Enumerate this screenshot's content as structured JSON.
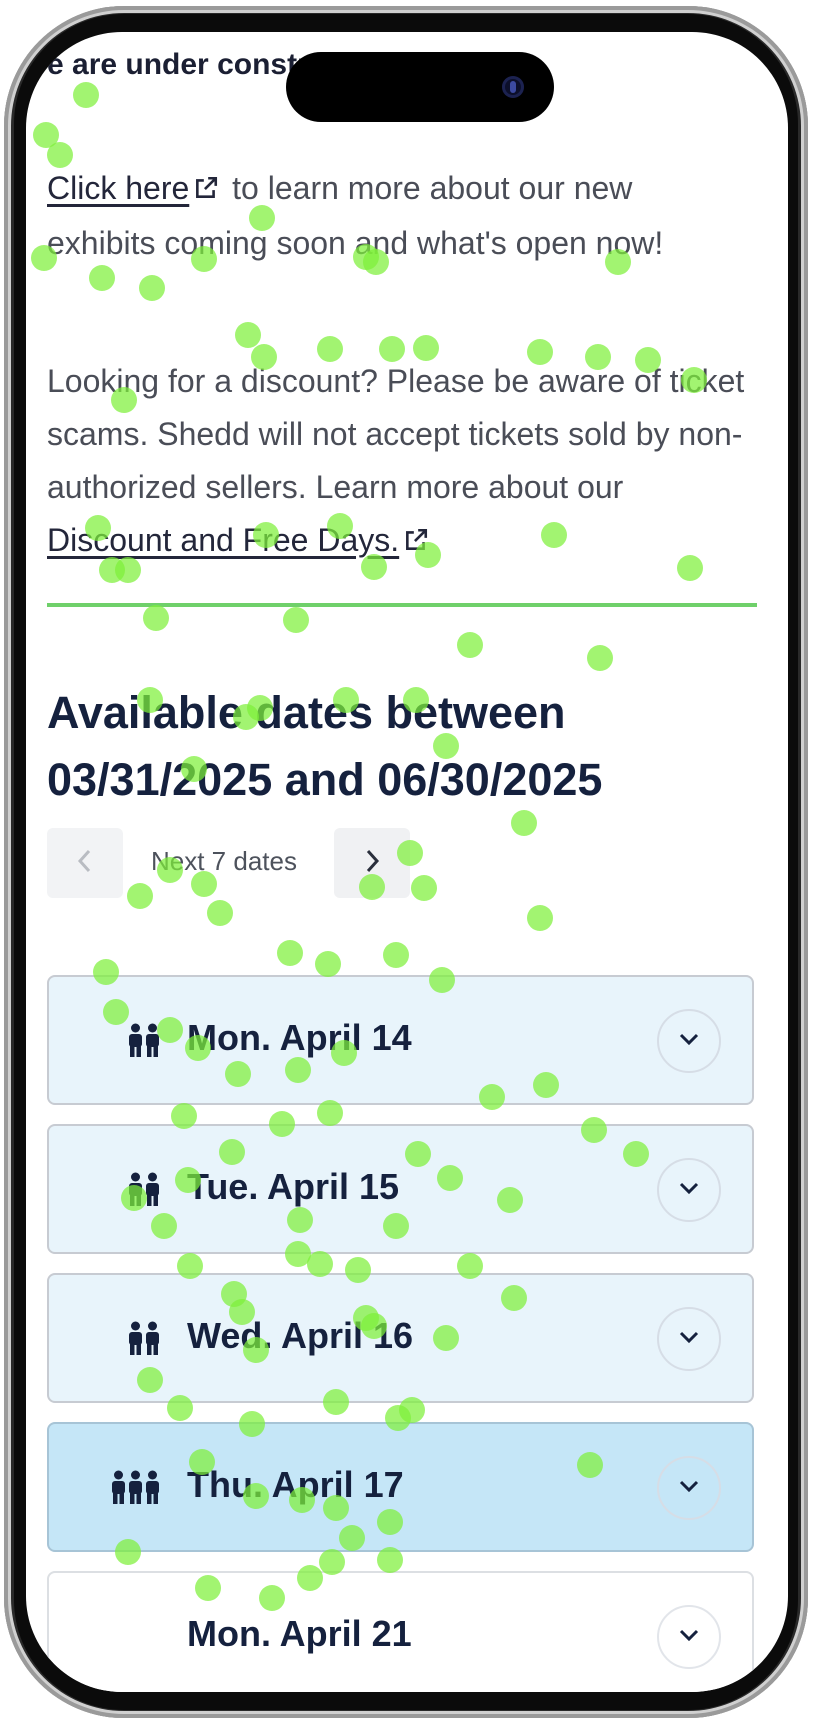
{
  "notice": {
    "title": "e are under construction!"
  },
  "paragraph1": {
    "link_text": "Click here",
    "rest_text": " to learn more about our new exhibits coming soon and what's open now!"
  },
  "paragraph2": {
    "text": "Looking for a discount? Please be aware of ticket scams. Shedd will not accept tickets sold by non-authorized sellers. Learn more about our ",
    "link_text": "Discount and Free Days."
  },
  "availability": {
    "title": "Available dates between 03/31/2025 and 06/30/2025"
  },
  "pager": {
    "label": "Next 7 dates",
    "prev_icon": "chevron-left-icon",
    "next_icon": "chevron-right-icon"
  },
  "dates": [
    {
      "label": "Mon. April 14",
      "crowd_icons": 2,
      "state": "light"
    },
    {
      "label": "Tue. April 15",
      "crowd_icons": 2,
      "state": "light"
    },
    {
      "label": "Wed. April 16",
      "crowd_icons": 2,
      "state": "light"
    },
    {
      "label": "Thu. April 17",
      "crowd_icons": 3,
      "state": "strong"
    },
    {
      "label": "Mon. April 21",
      "crowd_icons": 0,
      "state": "white"
    }
  ],
  "colors": {
    "divider": "#6fd06a",
    "heading": "#15213e",
    "row_light": "#e8f4fb",
    "row_strong": "#c5e6f7",
    "heat_dot": "#7ef03a"
  },
  "icons": {
    "external_link": "external-link-icon",
    "crowd": "person-icon",
    "expand": "chevron-down-icon"
  }
}
